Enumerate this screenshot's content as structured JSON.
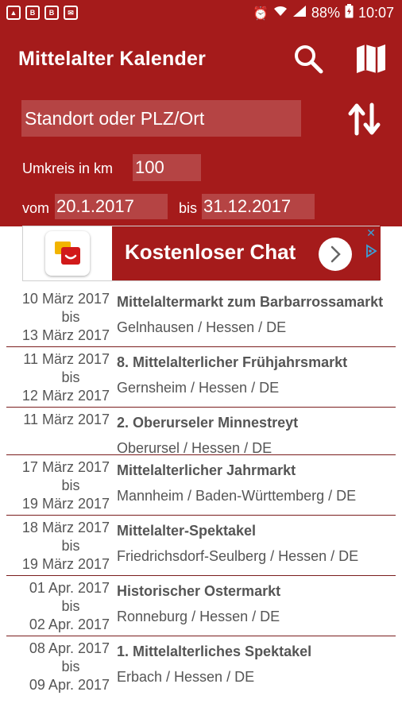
{
  "status_bar": {
    "battery": "88%",
    "time": "10:07"
  },
  "app_bar": {
    "title": "Mittelalter Kalender",
    "icons": [
      "search-icon",
      "map-icon"
    ]
  },
  "filter": {
    "location_placeholder": "Standort oder PLZ/Ort",
    "radius_label": "Umkreis in km",
    "radius_value": "100",
    "from_label": "vom",
    "from_value": "20.1.2017",
    "to_label": "bis",
    "to_value": "31.12.2017"
  },
  "ad": {
    "text": "Kostenloser Chat"
  },
  "events": [
    {
      "start": "10 März 2017",
      "sep": "bis",
      "end": "13 März 2017",
      "name": "Mittelaltermarkt zum Barbarrossamarkt",
      "location": "Gelnhausen / Hessen / DE"
    },
    {
      "start": "11 März 2017",
      "sep": "bis",
      "end": "12 März 2017",
      "name": "8.  Mittelalterlicher Frühjahrsmarkt",
      "location": "Gernsheim / Hessen / DE"
    },
    {
      "start": "11 März 2017",
      "sep": "",
      "end": "",
      "name": "2. Oberurseler Minnestreyt",
      "location": "Oberursel / Hessen / DE"
    },
    {
      "start": "17 März 2017",
      "sep": "bis",
      "end": "19 März 2017",
      "name": "Mittelalterlicher Jahrmarkt",
      "location": "Mannheim / Baden-Württemberg / DE"
    },
    {
      "start": "18 März 2017",
      "sep": "bis",
      "end": "19 März 2017",
      "name": "Mittelalter-Spektakel",
      "location": "Friedrichsdorf-Seulberg / Hessen / DE"
    },
    {
      "start": "01 Apr. 2017",
      "sep": "bis",
      "end": "02 Apr. 2017",
      "name": "Historischer Ostermarkt",
      "location": "Ronneburg / Hessen / DE"
    },
    {
      "start": "08 Apr. 2017",
      "sep": "bis",
      "end": "09 Apr. 2017",
      "name": "1. Mittelalterliches Spektakel",
      "location": "Erbach / Hessen / DE"
    }
  ],
  "colors": {
    "primary": "#a51b1b",
    "text": "#555555"
  }
}
